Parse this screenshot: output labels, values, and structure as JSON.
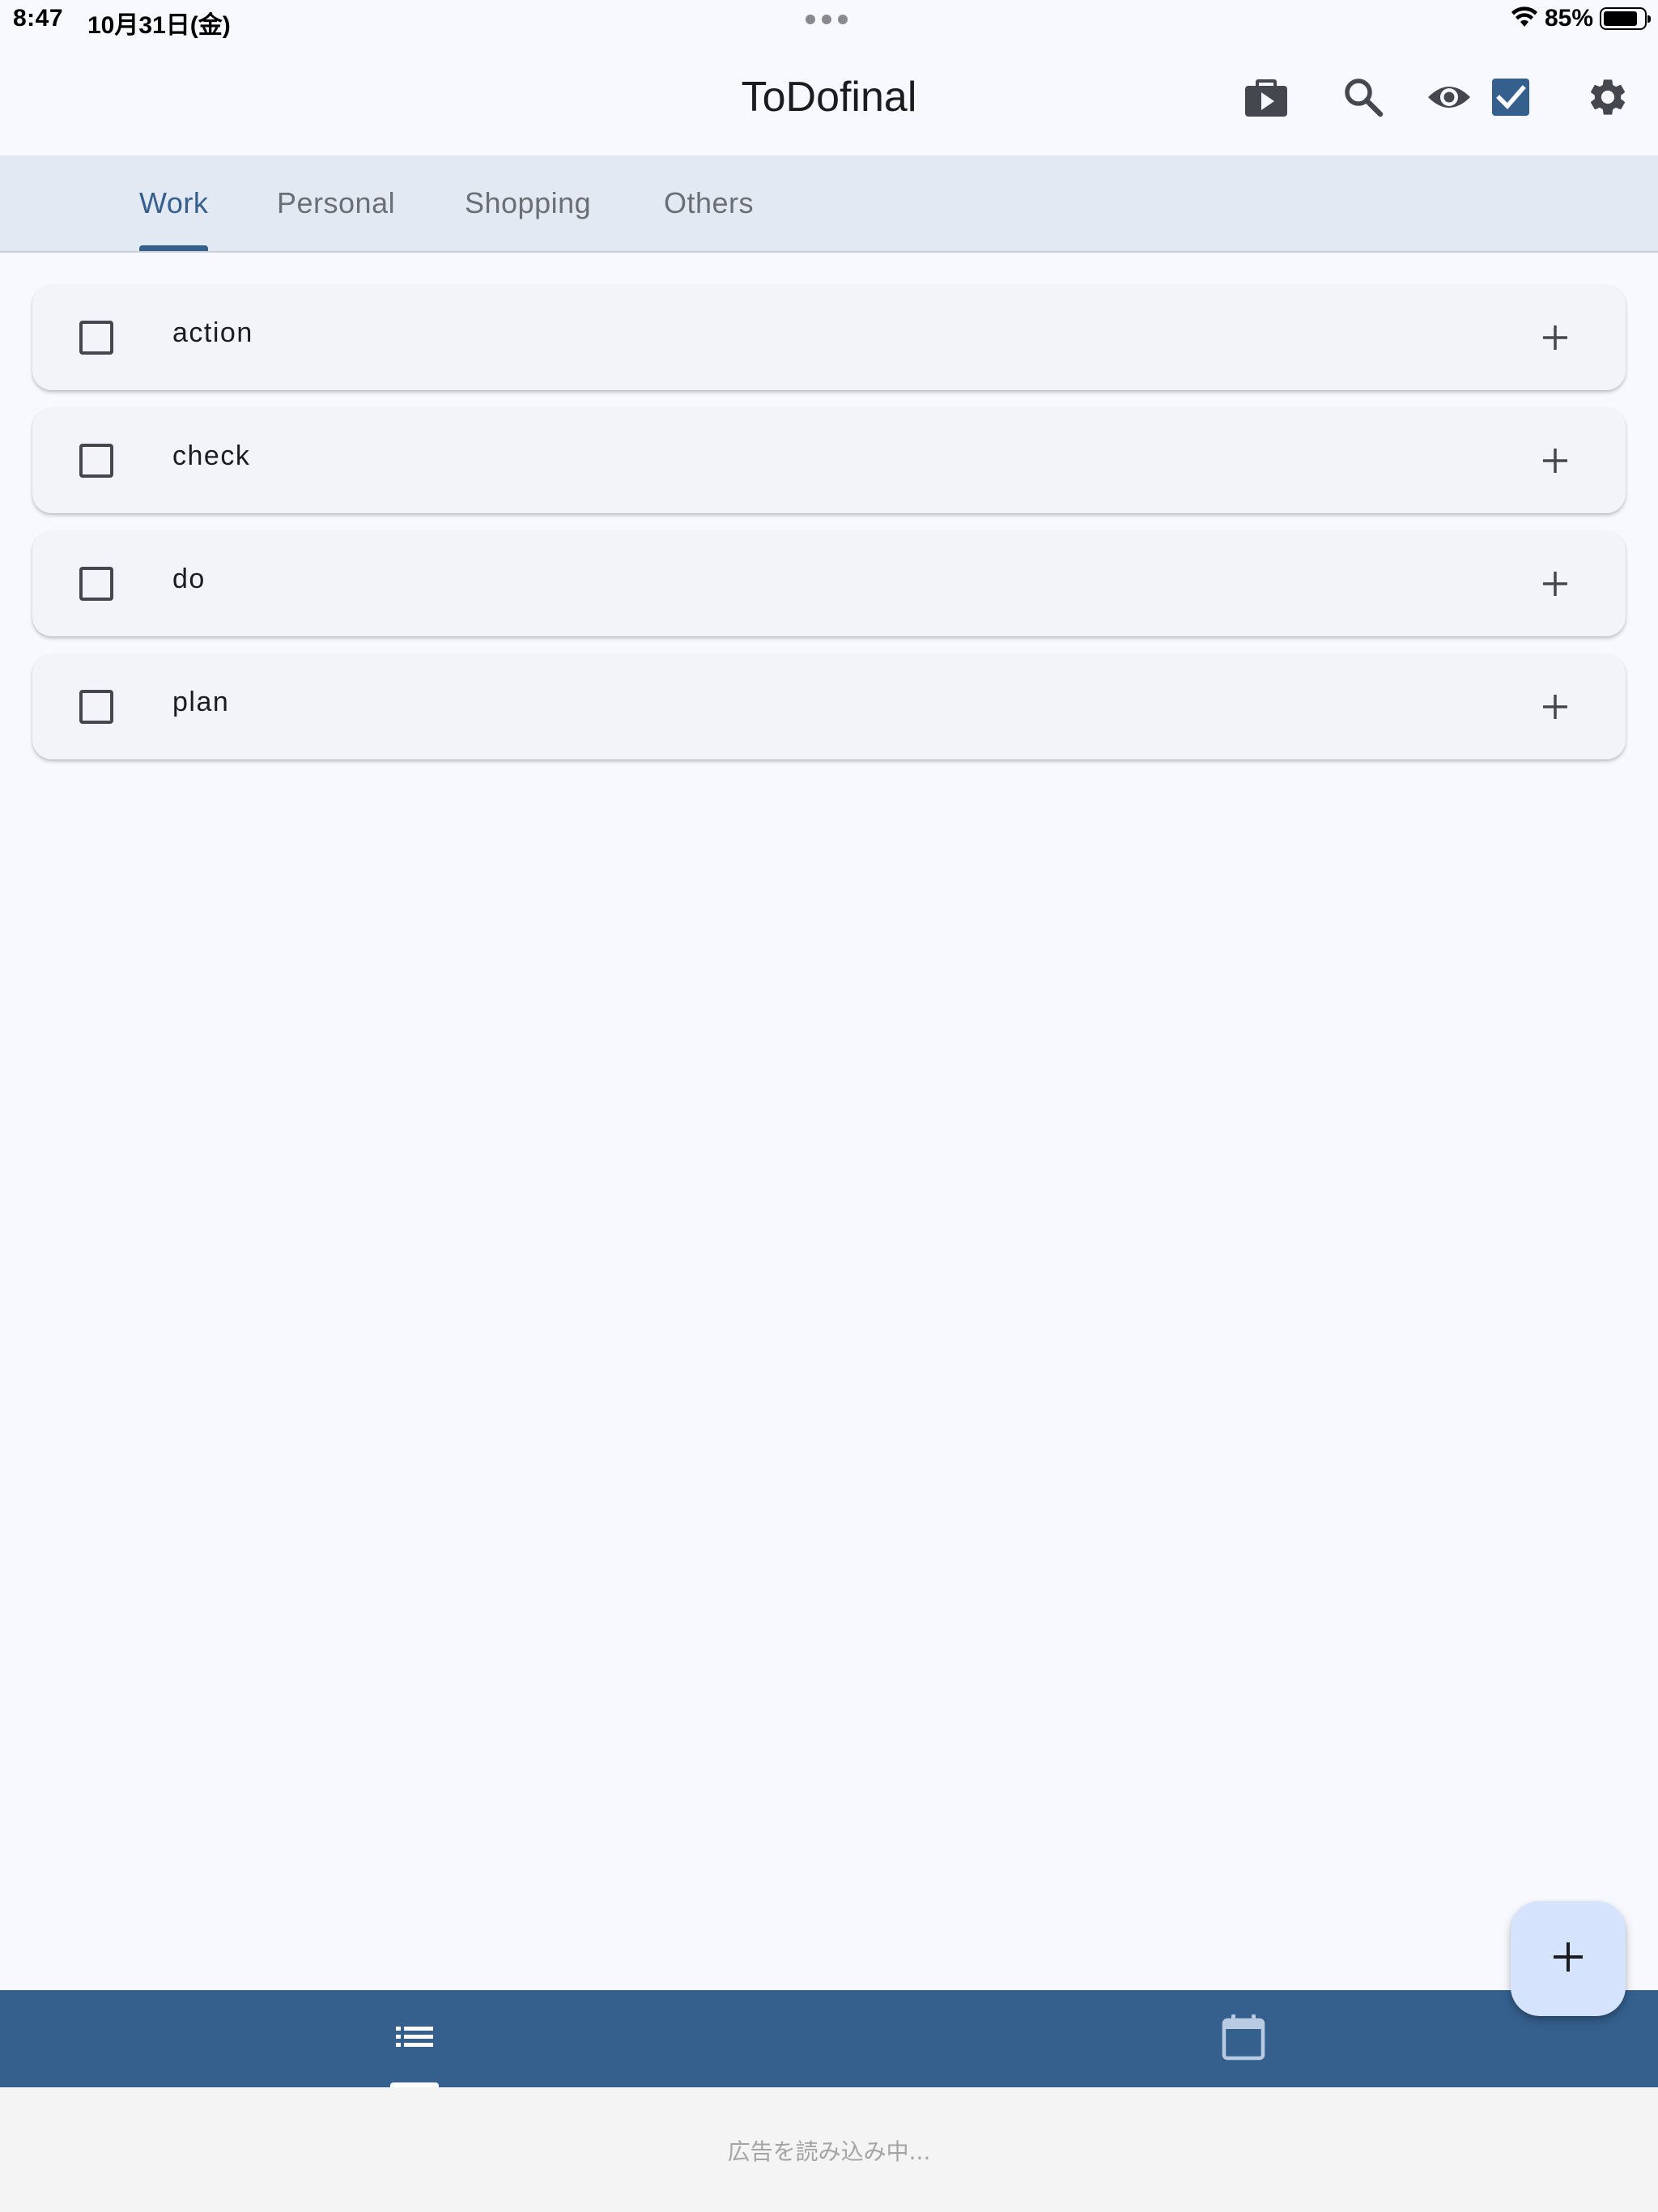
{
  "status_bar": {
    "time": "8:47",
    "date": "10月31日(金)",
    "battery": "85%",
    "battery_level": 0.85
  },
  "app_bar": {
    "title": "ToDofinal",
    "actions": [
      {
        "icon": "play-video-icon"
      },
      {
        "icon": "search-icon"
      },
      {
        "icon": "eye-icon"
      },
      {
        "icon": "checkbox-checked-icon"
      },
      {
        "icon": "gear-icon"
      }
    ]
  },
  "tabs": [
    {
      "label": "Work",
      "active": true
    },
    {
      "label": "Personal",
      "active": false
    },
    {
      "label": "Shopping",
      "active": false
    },
    {
      "label": "Others",
      "active": false
    }
  ],
  "tasks": [
    {
      "label": "action",
      "checked": false
    },
    {
      "label": "check",
      "checked": false
    },
    {
      "label": "do",
      "checked": false
    },
    {
      "label": "plan",
      "checked": false
    }
  ],
  "fab": {
    "icon": "plus-icon"
  },
  "bottom_nav": {
    "items": [
      {
        "icon": "list-icon",
        "active": true
      },
      {
        "icon": "calendar-icon",
        "active": false
      }
    ]
  },
  "ad": {
    "loading_text": "広告を読み込み中..."
  },
  "colors": {
    "primary": "#35608e",
    "tab_bar_bg": "#e3e9f3",
    "card_bg": "#f3f4fa",
    "fab_bg": "#d6e3fc",
    "page_bg": "#f7f9fe"
  }
}
